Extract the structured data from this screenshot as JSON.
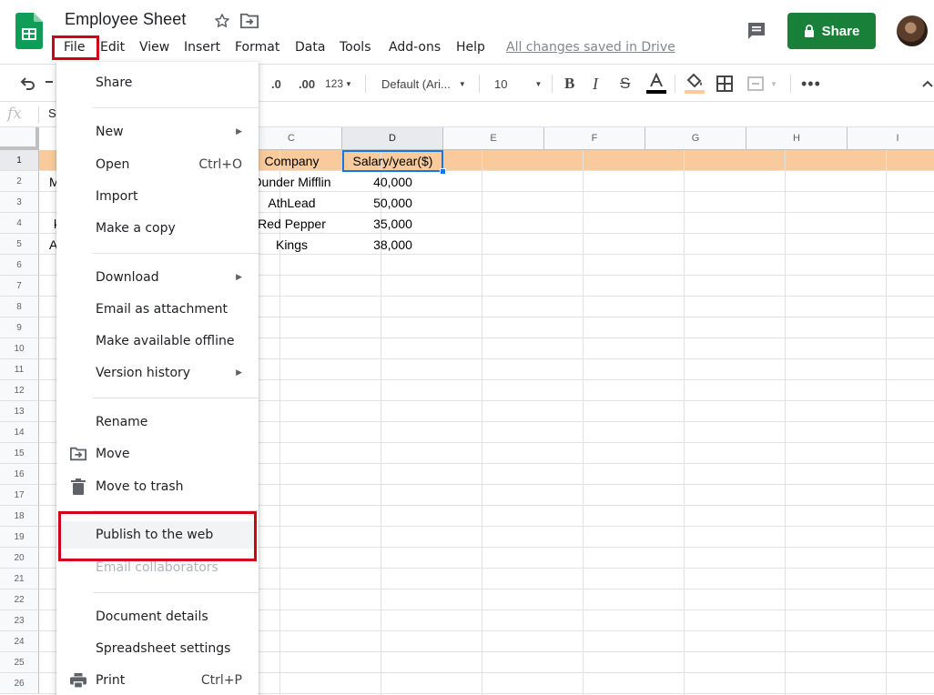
{
  "header": {
    "doc_title": "Employee Sheet",
    "save_status": "All changes saved in Drive",
    "share_label": "Share",
    "accent_color": "#188038",
    "logo_icon": "google-sheets-logo",
    "star_icon": "star-outline",
    "move_icon": "folder-move",
    "comment_icon": "comment-history"
  },
  "menubar": {
    "items": [
      "File",
      "Edit",
      "View",
      "Insert",
      "Format",
      "Data",
      "Tools",
      "Add-ons",
      "Help"
    ]
  },
  "toolbar": {
    "decrease_decimal": ".0",
    "increase_decimal": ".00",
    "number_format": "123",
    "font_family": "Default (Ari...",
    "font_size": "10"
  },
  "formula_bar": {
    "fx": "fx",
    "content": "S"
  },
  "grid": {
    "columns": [
      "C",
      "D",
      "E",
      "F",
      "G",
      "H",
      "I"
    ],
    "rows": [
      "1",
      "2",
      "3",
      "4",
      "5",
      "6",
      "7",
      "8",
      "9",
      "10",
      "11",
      "12",
      "13",
      "14",
      "15",
      "16",
      "17",
      "18",
      "19",
      "20",
      "21",
      "22",
      "23",
      "24",
      "25",
      "26"
    ],
    "visible_a_fragments": [
      "M",
      "",
      "k",
      "A"
    ],
    "company": [
      "Company",
      "Dunder Mifflin",
      "AthLead",
      "Red Pepper",
      "Kings"
    ],
    "salary": [
      "Salary/year($)",
      "40,000",
      "50,000",
      "35,000",
      "38,000"
    ],
    "header_fill_color": "#f9cb9c",
    "selection_color": "#1a73e8"
  },
  "file_menu": {
    "share": "Share",
    "new": "New",
    "open": "Open",
    "open_shortcut": "Ctrl+O",
    "import": "Import",
    "make_copy": "Make a copy",
    "download": "Download",
    "email_attachment": "Email as attachment",
    "offline": "Make available offline",
    "version_history": "Version history",
    "rename": "Rename",
    "move": "Move",
    "trash": "Move to trash",
    "publish": "Publish to the web",
    "email_collaborators": "Email collaborators",
    "document_details": "Document details",
    "spreadsheet_settings": "Spreadsheet settings",
    "print": "Print",
    "print_shortcut": "Ctrl+P"
  },
  "annotations": {
    "highlight_color": "#d0021b"
  }
}
